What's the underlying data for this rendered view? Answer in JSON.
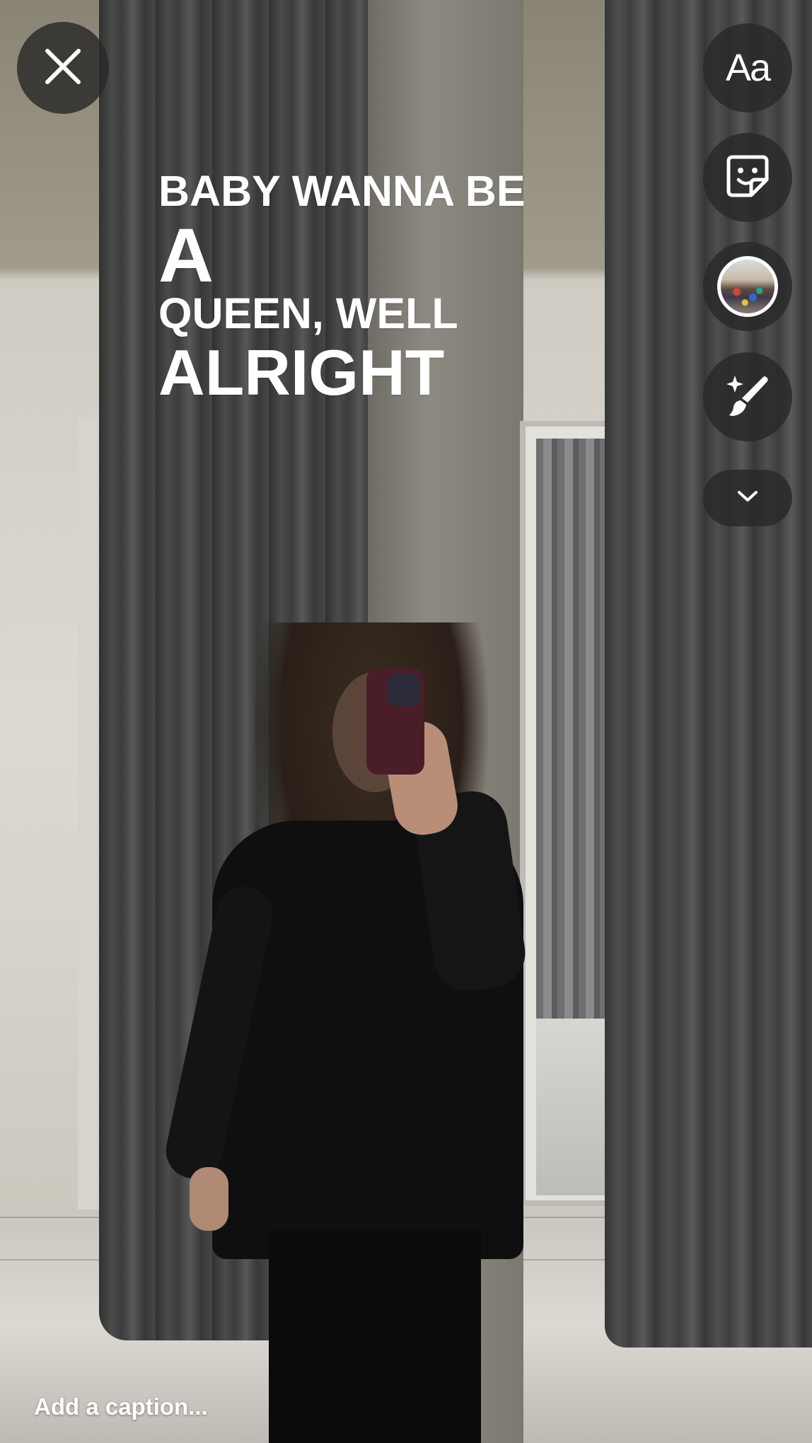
{
  "toolbar": {
    "close_icon": "close-icon",
    "text_tool_label": "Aa",
    "sticker_icon": "sticker-icon",
    "photo_icon": "photo-thumbnail",
    "effects_icon": "sparkle-brush-icon",
    "more_icon": "chevron-down-icon"
  },
  "overlay_text": {
    "line1": "BABY WANNA BE",
    "line2": "A",
    "line3": "QUEEN, WELL",
    "line4": "ALRIGHT"
  },
  "caption": {
    "placeholder": "Add a caption..."
  },
  "colors": {
    "button_bg": "#282828",
    "text": "#ffffff"
  }
}
